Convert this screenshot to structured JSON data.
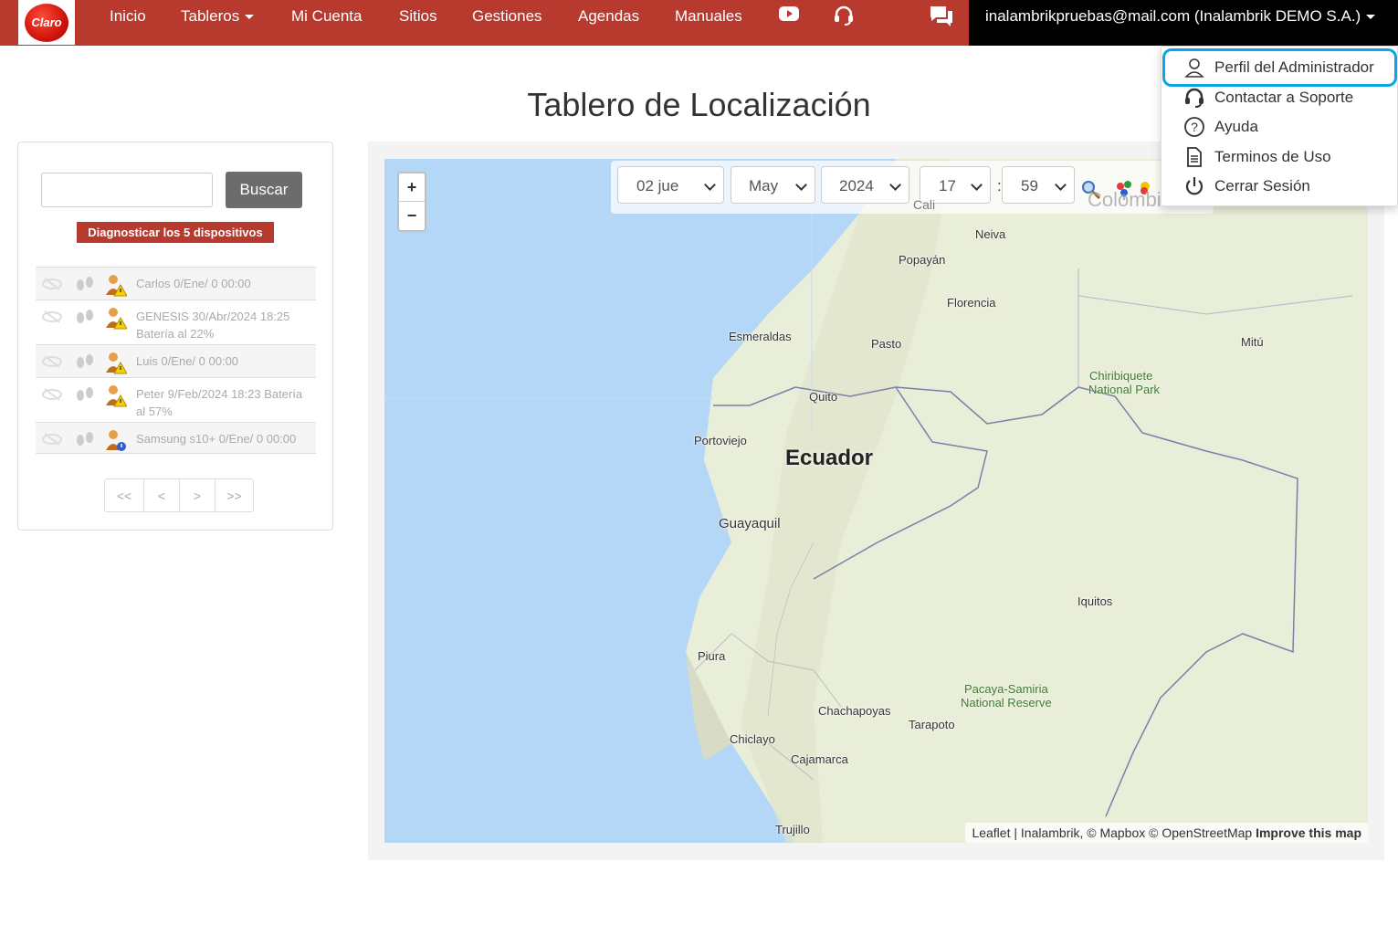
{
  "brand": {
    "logo_text": "Claro"
  },
  "nav": {
    "items": [
      {
        "label": "Inicio"
      },
      {
        "label": "Tableros"
      },
      {
        "label": "Mi Cuenta"
      },
      {
        "label": "Sitios"
      },
      {
        "label": "Gestiones"
      },
      {
        "label": "Agendas"
      },
      {
        "label": "Manuales"
      }
    ],
    "icons": [
      "youtube-icon",
      "headset-icon",
      "chat-icon"
    ],
    "user_label": "inalambrikpruebas@mail.com (Inalambrik DEMO S.A.)"
  },
  "page": {
    "title": "Tablero de Localización"
  },
  "sidebar": {
    "search_placeholder": "",
    "search_button": "Buscar",
    "diagnose_button": "Diagnosticar los 5 dispositivos",
    "devices": [
      {
        "line1": "Carlos 0/Ene/ 0 00:00",
        "line2": "",
        "status": "warning"
      },
      {
        "line1": "GENESIS 30/Abr/2024 18:25",
        "line2": "Batería al 22%",
        "status": "warning"
      },
      {
        "line1": "Luis 0/Ene/ 0 00:00",
        "line2": "",
        "status": "warning"
      },
      {
        "line1": "Peter 9/Feb/2024 18:23 Batería",
        "line2": "al 57%",
        "status": "warning"
      },
      {
        "line1": "Samsung s10+ 0/Ene/ 0 00:00",
        "line2": "",
        "status": "info"
      }
    ],
    "pager": [
      "<<",
      "<",
      ">",
      ">>"
    ]
  },
  "map": {
    "zoom_in": "+",
    "zoom_out": "−",
    "date": {
      "day": "02 jue",
      "month": "May",
      "year": "2024",
      "hour": "17",
      "minute": "59",
      "separator": ":"
    },
    "places": {
      "cali": "Cali",
      "neiva": "Neiva",
      "popayan": "Popayán",
      "florencia": "Florencia",
      "pasto": "Pasto",
      "esmeraldas": "Esmeraldas",
      "mitu": "Mitú",
      "quito": "Quito",
      "portoviejo": "Portoviejo",
      "ecuador": "Ecuador",
      "guayaquil": "Guayaquil",
      "iquitos": "Iquitos",
      "piura": "Piura",
      "chachapoyas": "Chachapoyas",
      "tarapoto": "Tarapoto",
      "chiclayo": "Chiclayo",
      "cajamarca": "Cajamarca",
      "trujillo": "Trujillo",
      "colombia": "Colombia",
      "chiribiquete": "Chiribiquete\nNational Park",
      "pacaya": "Pacaya-Samiria\nNational Reserve"
    },
    "attribution": {
      "text": "Leaflet | Inalambrik, © Mapbox © OpenStreetMap",
      "bold": "Improve this map"
    },
    "colors": {
      "sea": "#b4d6f7",
      "land": "#e9eed9",
      "border": "#7b7fa8"
    }
  },
  "user_menu": {
    "items": [
      {
        "label": "Perfil del Administrador",
        "icon": "user-icon"
      },
      {
        "label": "Contactar a Soporte",
        "icon": "headset-icon"
      },
      {
        "label": "Ayuda",
        "icon": "help-icon"
      },
      {
        "label": "Terminos de Uso",
        "icon": "document-icon"
      },
      {
        "label": "Cerrar Sesión",
        "icon": "power-icon"
      }
    ],
    "highlighted_index": 0,
    "highlight_color": "#0aa5e6"
  }
}
